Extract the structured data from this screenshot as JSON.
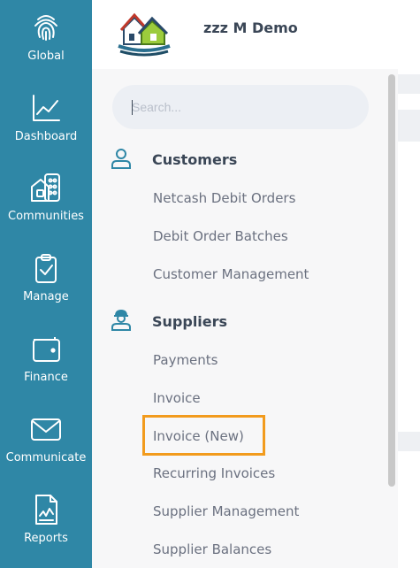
{
  "rail": {
    "items": [
      {
        "label": "Global",
        "icon": "fingerprint-icon"
      },
      {
        "label": "Dashboard",
        "icon": "line-chart-icon"
      },
      {
        "label": "Communities",
        "icon": "buildings-icon"
      },
      {
        "label": "Manage",
        "icon": "clipboard-check-icon"
      },
      {
        "label": "Finance",
        "icon": "wallet-icon"
      },
      {
        "label": "Communicate",
        "icon": "envelope-icon"
      },
      {
        "label": "Reports",
        "icon": "report-document-icon"
      }
    ]
  },
  "header": {
    "company_name": "zzz M Demo"
  },
  "search": {
    "placeholder": "Search..."
  },
  "menu": {
    "customers": {
      "title": "Customers",
      "items": [
        "Netcash Debit Orders",
        "Debit Order Batches",
        "Customer Management"
      ]
    },
    "suppliers": {
      "title": "Suppliers",
      "items": [
        "Payments",
        "Invoice",
        "Invoice (New)",
        "Recurring Invoices",
        "Supplier Management",
        "Supplier Balances"
      ]
    }
  },
  "colors": {
    "rail": "#2f87a6",
    "highlight": "#f29b1d",
    "accent_icon": "#2f87a6"
  }
}
